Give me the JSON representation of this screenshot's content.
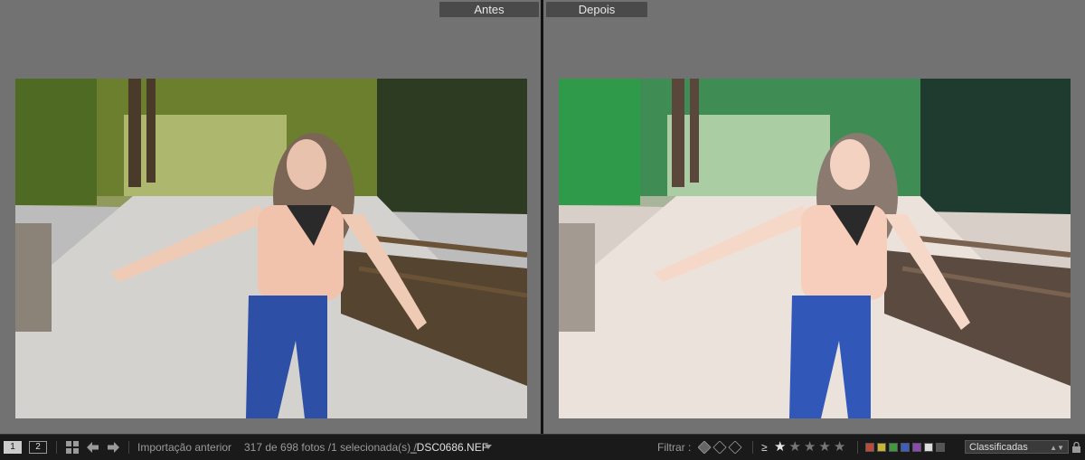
{
  "compare": {
    "before_label": "Antes",
    "after_label": "Depois"
  },
  "filmstrip": {
    "monitor_1": "1",
    "monitor_2": "2",
    "source": "Importação anterior",
    "count_text": "317 de 698 fotos /1 selecionada(s) /",
    "filename": "_DSC0686.NEF",
    "filter_label": "Filtrar :",
    "rating_operator": "≥",
    "rating_value": 1,
    "rating_max": 5,
    "sort_selected": "Classificadas"
  },
  "colors": {
    "background": "#727272",
    "filmstrip": "#1a1a1a",
    "label_red": "#c04a3a",
    "label_yellow": "#c9b530",
    "label_green": "#3f9a3f",
    "label_blue": "#3a5fc0",
    "label_purple": "#8a4ab0"
  },
  "icons": [
    "grid-icon",
    "arrow-left-icon",
    "arrow-right-icon",
    "dropdown-arrow-icon",
    "flag-icon",
    "star-icon"
  ]
}
